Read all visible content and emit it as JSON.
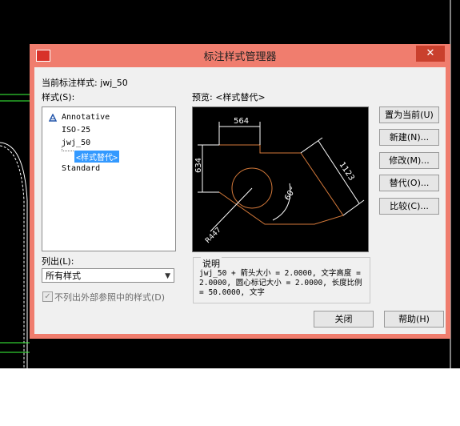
{
  "window": {
    "title": "标注样式管理器",
    "close_glyph": "✕"
  },
  "current_style": "当前标注样式: jwj_50",
  "styles_label": "样式(S):",
  "styles": [
    "Annotative",
    "ISO-25",
    "jwj_50",
    "<样式替代>",
    "Standard"
  ],
  "preview_label": "预览: <样式替代>",
  "preview_dims": {
    "width": "564",
    "height": "634",
    "radius": "R447",
    "angle": "60°",
    "diag": "1123"
  },
  "list_label": "列出(L):",
  "list_value": "所有样式",
  "exclude_xref_label": "不列出外部参照中的样式(D)",
  "description_label": "说明",
  "description_text": "jwj_50 + 箭头大小 = 2.0000, 文字高度 = 2.0000, 圆心标记大小 = 2.0000, 长度比例 = 50.0000, 文字",
  "buttons": {
    "set_current": "置为当前(U)",
    "new": "新建(N)...",
    "modify": "修改(M)...",
    "override": "替代(O)...",
    "compare": "比较(C)...",
    "close": "关闭",
    "help": "帮助(H)"
  },
  "colors": {
    "title_bar": "#f07d6e",
    "preview_geometry": "#d4793a",
    "dimension": "#ffffff",
    "selection": "#3399ff"
  }
}
